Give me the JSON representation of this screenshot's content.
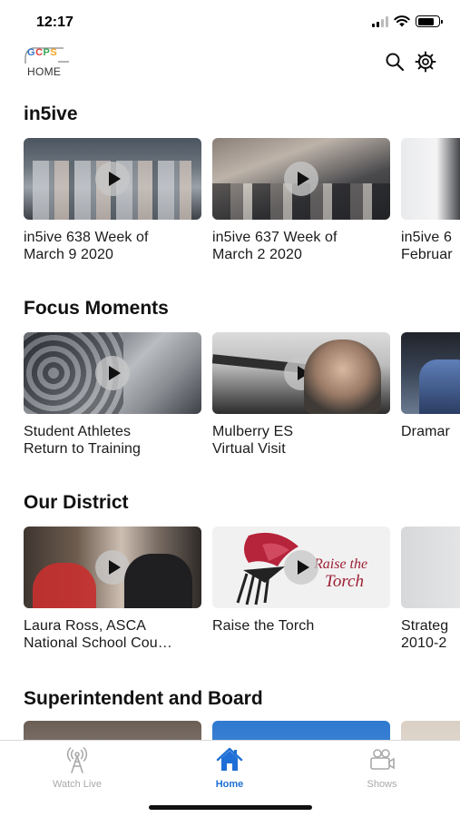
{
  "status_bar": {
    "time": "12:17"
  },
  "header": {
    "logo_top": "GCPS",
    "logo_bottom": "HOME",
    "search_icon": "search-icon",
    "settings_icon": "gear-icon"
  },
  "sections": [
    {
      "title": "in5ive",
      "cards": [
        {
          "title_line1": "in5ive 638 Week of",
          "title_line2": "March 9 2020",
          "thumbnail": "students group photo"
        },
        {
          "title_line1": "in5ive 637 Week of",
          "title_line2": "March 2 2020",
          "thumbnail": "students with goggles"
        },
        {
          "title_line1": "in5ive 6",
          "title_line2": "Februar",
          "thumbnail": "men in suits"
        }
      ]
    },
    {
      "title": "Focus Moments",
      "cards": [
        {
          "title_line1": "Student Athletes",
          "title_line2": "Return to Training",
          "thumbnail": "helmets rack"
        },
        {
          "title_line1": "Mulberry ES",
          "title_line2": "Virtual Visit",
          "thumbnail": "plane and aviator"
        },
        {
          "title_line1": "Dramar",
          "title_line2": "",
          "thumbnail": "stage performers"
        }
      ]
    },
    {
      "title": "Our District",
      "cards": [
        {
          "title_line1": "Laura Ross, ASCA",
          "title_line2": "National School Cou…",
          "thumbnail": "two people seated"
        },
        {
          "title_line1": "Raise the Torch",
          "title_line2": "",
          "thumbnail": "torch illustration",
          "thumb_text": "Raise the Torch"
        },
        {
          "title_line1": "Strateg",
          "title_line2": "2010-2",
          "thumbnail": "document slide"
        }
      ]
    },
    {
      "title": "Superintendent and Board",
      "cards": [
        {
          "title_line1": "",
          "title_line2": "",
          "thumbnail": "photo"
        },
        {
          "title_line1": "",
          "title_line2": "",
          "thumbnail": "blue graphic"
        },
        {
          "title_line1": "",
          "title_line2": "",
          "thumbnail": "beige graphic"
        }
      ]
    }
  ],
  "tab_bar": {
    "tabs": [
      {
        "label": "Watch Live",
        "icon": "broadcast-tower-icon",
        "active": false
      },
      {
        "label": "Home",
        "icon": "home-icon",
        "active": true
      },
      {
        "label": "Shows",
        "icon": "video-camera-icon",
        "active": false
      }
    ]
  },
  "colors": {
    "accent": "#1f6fd6",
    "inactive_tab": "#a9a9a9",
    "text": "#111111"
  }
}
